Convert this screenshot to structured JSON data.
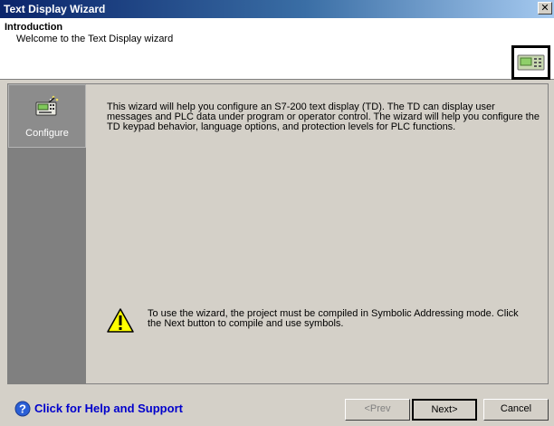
{
  "window": {
    "title": "Text Display Wizard",
    "close_glyph": "✕"
  },
  "header": {
    "title": "Introduction",
    "subtitle": "Welcome to the Text Display wizard",
    "icon": "text-display-device-icon"
  },
  "sidebar": {
    "items": [
      {
        "label": "Configure",
        "icon": "configure-display-icon",
        "selected": true
      }
    ]
  },
  "main": {
    "intro": "This wizard will help you configure an S7-200 text display (TD). The TD can display user messages and PLC data under program or operator control. The wizard will help you configure the TD keypad behavior, language options, and protection levels for PLC functions.",
    "warning_icon": "warning-icon",
    "warning": "To use the wizard, the project must be compiled in Symbolic Addressing mode.  Click the Next button to compile and use symbols."
  },
  "footer": {
    "help_label": "Click for Help and Support",
    "help_icon": "help-icon",
    "prev_label": "<Prev",
    "next_label": "Next>",
    "cancel_label": "Cancel"
  },
  "colors": {
    "titlebar_start": "#0a246a",
    "titlebar_end": "#a6caf0",
    "dialog_bg": "#d4d0c8",
    "sidebar_bg": "#808080",
    "help_link": "#0000cc"
  }
}
